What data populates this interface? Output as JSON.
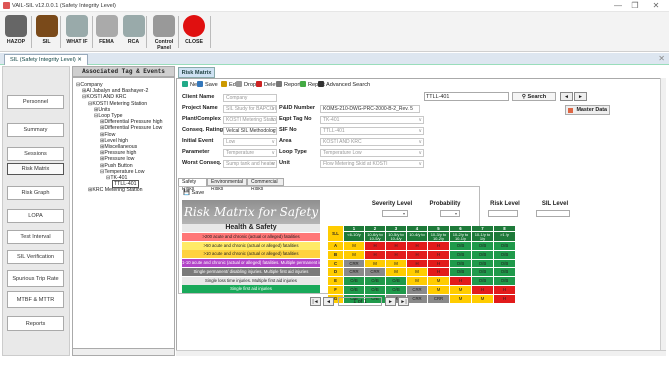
{
  "window": {
    "title": "VAIL-SIL v12.0.0.1 (Safety Integrity Level)",
    "min": "—",
    "max": "❐",
    "close": "✕"
  },
  "ribbon": [
    {
      "label": "HAZOP",
      "icon": "hazop-icon",
      "color": "#666"
    },
    {
      "label": "SIL",
      "icon": "sil-icon",
      "color": "#7a4a1a"
    },
    {
      "label": "WHAT IF",
      "icon": "house-icon",
      "color": "#9aa"
    },
    {
      "label": "FEMA",
      "icon": "fema-icon",
      "color": "#aaa"
    },
    {
      "label": "RCA",
      "icon": "rca-icon",
      "color": "#9aa"
    },
    {
      "label": "Control Panel",
      "icon": "gear-icon",
      "color": "#999"
    },
    {
      "label": "CLOSE",
      "icon": "close-circle-icon",
      "color": "#e01010"
    }
  ],
  "doc_tab": {
    "label": "SIL (Safety Integrity Level)",
    "close": "✕"
  },
  "panel_close": "✕",
  "nav": [
    "Personnel",
    "Summary",
    "Sessions",
    "Risk Matrix",
    "Risk Graph",
    "LOPA",
    "Test Interval",
    "SIL Verification",
    "Spurious Trip Rate",
    "MTBF & MTTR",
    "Reports"
  ],
  "tree_header": "Associated Tag & Events",
  "tree": [
    {
      "label": "Company",
      "sign": "⊟",
      "indent": 0
    },
    {
      "label": "Al Jabalyn and Bashayer-2",
      "sign": "⊞",
      "indent": 1
    },
    {
      "label": "KOSTI AND KRC",
      "sign": "⊟",
      "indent": 1
    },
    {
      "label": "KOSTI Metering Station",
      "sign": "⊟",
      "indent": 2
    },
    {
      "label": "Units",
      "sign": "⊞",
      "indent": 3
    },
    {
      "label": "Loop Type",
      "sign": "⊟",
      "indent": 3
    },
    {
      "label": "Differential Pressure high",
      "sign": "⊞",
      "indent": 4
    },
    {
      "label": "Differential Pressure Low",
      "sign": "⊞",
      "indent": 4
    },
    {
      "label": "Flow",
      "sign": "⊞",
      "indent": 4
    },
    {
      "label": "Level high",
      "sign": "⊞",
      "indent": 4
    },
    {
      "label": "Miscellaneous",
      "sign": "⊞",
      "indent": 4
    },
    {
      "label": "Pressure high",
      "sign": "⊞",
      "indent": 4
    },
    {
      "label": "Pressure low",
      "sign": "⊞",
      "indent": 4
    },
    {
      "label": "Push Button",
      "sign": "⊞",
      "indent": 4
    },
    {
      "label": "Temperature Low",
      "sign": "⊟",
      "indent": 4
    },
    {
      "label": "TK-401",
      "sign": "⊟",
      "indent": 5
    },
    {
      "label": "TTLL-401",
      "sign": "",
      "indent": 6
    },
    {
      "label": "KRC Metering Station",
      "sign": "⊞",
      "indent": 2
    }
  ],
  "active_tab": "Risk Matrix",
  "toolbar": [
    "New",
    "Save",
    "Edit",
    "Drop",
    "Delete",
    "Report",
    "Report",
    "Advanced Search"
  ],
  "search": {
    "value": "TTLL-401",
    "button": "Search",
    "prev": "◄",
    "next": "►",
    "master": "Master Data"
  },
  "fields_left": [
    {
      "label": "Client Name",
      "value": "Company"
    },
    {
      "label": "Project Name",
      "value": "SIL Study for BAPCO Pipeline 5"
    },
    {
      "label": "Plant/Complex",
      "value": "KOSTI Metering Station"
    },
    {
      "label": "Conseq. Rating",
      "value": "Velcal SIL Methodology"
    },
    {
      "label": "Initial Event",
      "value": "Low"
    },
    {
      "label": "Parameter",
      "value": "Temperature"
    },
    {
      "label": "Worst Conseq.",
      "value": "Sump tank and heater damage"
    }
  ],
  "fields_right": [
    {
      "label": "P&ID Number",
      "value": "KOMS-210-DWG-PRC-2000-B-2_Rev. 5"
    },
    {
      "label": "Eqpt Tag No",
      "value": "TK-401"
    },
    {
      "label": "SIF No",
      "value": "TTLL-401"
    },
    {
      "label": "Area",
      "value": "KOSTI AND KRC"
    },
    {
      "label": "Loop Type",
      "value": "Temperature Low"
    },
    {
      "label": "Unit",
      "value": "Flow Metering Skid at KOSTI"
    }
  ],
  "subtabs": [
    "Safety Risks",
    "Environmental Risks",
    "Commercial Risks"
  ],
  "inner_save": "Save",
  "matrix_title": "Risk Matrix for Safety",
  "hs_header": "Health & Safety",
  "hs_rows": [
    {
      "text": ">200 acute and chronic (actual or alleged) fatalities",
      "bg": "#ff7777",
      "fg": "#222"
    },
    {
      "text": ">50 acute and chronic (actual or alleged) fatalities",
      "bg": "#ffeb66",
      "fg": "#222"
    },
    {
      "text": ">10 acute and chronic (actual or alleged) fatalities",
      "bg": "#ffd23f",
      "fg": "#222"
    },
    {
      "text": "1-10 acute and chronic (actual or alleged) fatalities. Multiple permanent injuries or irreversible health effects",
      "bg": "#b245c8",
      "fg": "#fff"
    },
    {
      "text": "Single permanent/ disabling injuries. Multiple first aid injuries",
      "bg": "#7a7a7a",
      "fg": "#fff"
    },
    {
      "text": "Single loss time injuries. Multiple first aid injuries",
      "bg": "#e8e8e8",
      "fg": "#222"
    },
    {
      "text": "Single first aid injuries",
      "bg": "#19a95a",
      "fg": "#fff"
    }
  ],
  "col_titles": {
    "severity": "Severity Level",
    "probability": "Probability",
    "risk": "Risk Level",
    "sil": "SIL Level"
  },
  "matrix": {
    "sl_label": "S.L",
    "col_nums": [
      "1",
      "2",
      "3",
      "4",
      "5",
      "6",
      "7",
      "8"
    ],
    "col_labels": [
      "<6-10/y",
      "10-6/y to 10-5/y",
      "10-5/y to 10-4/y",
      "10-4/y to",
      "10-3/y to 10-2/y",
      "10-2/y to 10-1/y",
      "10-1/y to 1/y",
      ">1 /y"
    ],
    "rows": [
      {
        "id": "A",
        "cells": [
          "M",
          "H",
          "H",
          "H",
          "H",
          "O/B",
          "O/B",
          "O/B"
        ]
      },
      {
        "id": "B",
        "cells": [
          "M",
          "H",
          "H",
          "H",
          "H",
          "O/B",
          "O/B",
          "O/B"
        ]
      },
      {
        "id": "C",
        "cells": [
          "CRR",
          "M",
          "M",
          "H",
          "H",
          "O/B",
          "O/B",
          "O/B"
        ]
      },
      {
        "id": "D",
        "cells": [
          "CRR",
          "CRR",
          "M",
          "M",
          "H",
          "O/B",
          "O/B",
          "O/B"
        ]
      },
      {
        "id": "E",
        "cells": [
          "O/B",
          "O/B",
          "O/B",
          "M",
          "M",
          "H",
          "O/B",
          "O/B"
        ]
      },
      {
        "id": "F",
        "cells": [
          "O/B",
          "O/B",
          "O/B",
          "CRR",
          "M",
          "M",
          "H",
          "H"
        ]
      },
      {
        "id": "G",
        "cells": [
          "O/B",
          "O/B",
          "CRR",
          "CRR",
          "CRR",
          "M",
          "M",
          "H"
        ]
      }
    ]
  },
  "pager": {
    "first": "|◄",
    "prev": "◄",
    "page": "1 of 1",
    "next": "►",
    "last": "►|"
  },
  "colors": {
    "H": "#e21b1b",
    "M": "#ffcc00",
    "CRR": "#8a8a8a",
    "O/B": "#1f9a4b",
    "header": "#1e7a3a"
  }
}
